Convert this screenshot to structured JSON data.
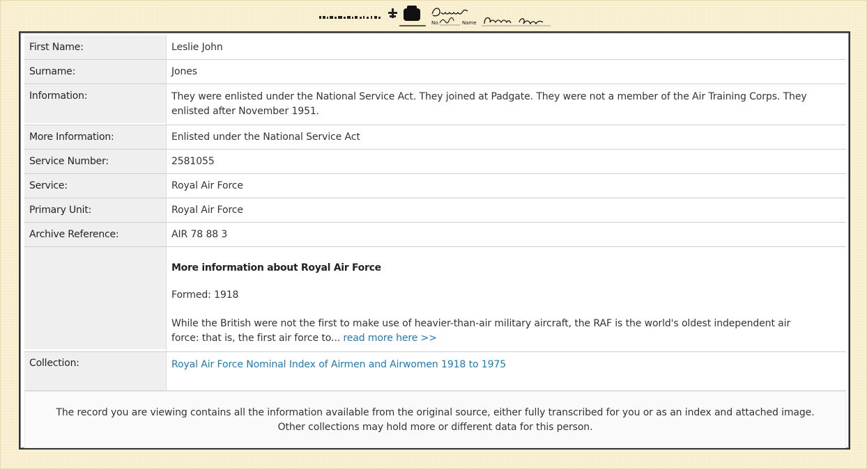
{
  "record": {
    "rows": [
      {
        "label": "First Name:",
        "value": "Leslie John"
      },
      {
        "label": "Surname:",
        "value": "Jones"
      },
      {
        "label": "Information:",
        "value": "They were enlisted under the National Service Act. They joined at Padgate. They were not a member of the Air Training Corps. They enlisted after November 1951."
      },
      {
        "label": "More Information:",
        "value": "Enlisted under the National Service Act"
      },
      {
        "label": "Service Number:",
        "value": "2581055"
      },
      {
        "label": "Service:",
        "value": "Royal Air Force"
      },
      {
        "label": "Primary Unit:",
        "value": "Royal Air Force"
      },
      {
        "label": "Archive Reference:",
        "value": "AIR 78 88 3"
      }
    ],
    "more_about": {
      "title": "More information about Royal Air Force",
      "formed": "Formed: 1918",
      "description": "While the British were not the first to make use of heavier-than-air military aircraft, the RAF is the world's oldest independent air force: that is, the first air force to...",
      "read_more": "read more here  >>"
    },
    "collection": {
      "label": "Collection:",
      "value": "Royal Air Force Nominal Index of Airmen and Airwomen 1918 to 1975"
    }
  },
  "footer": {
    "line1": "The record you are viewing contains all the information available from the original source, either fully transcribed for you or as an index and attached image.",
    "line2": "Other collections may hold more or different data for this person."
  },
  "header_image": {
    "text_duplicate": "Duplicate",
    "text_no": "No.",
    "text_name": "Name",
    "icon": "crest-icon"
  }
}
